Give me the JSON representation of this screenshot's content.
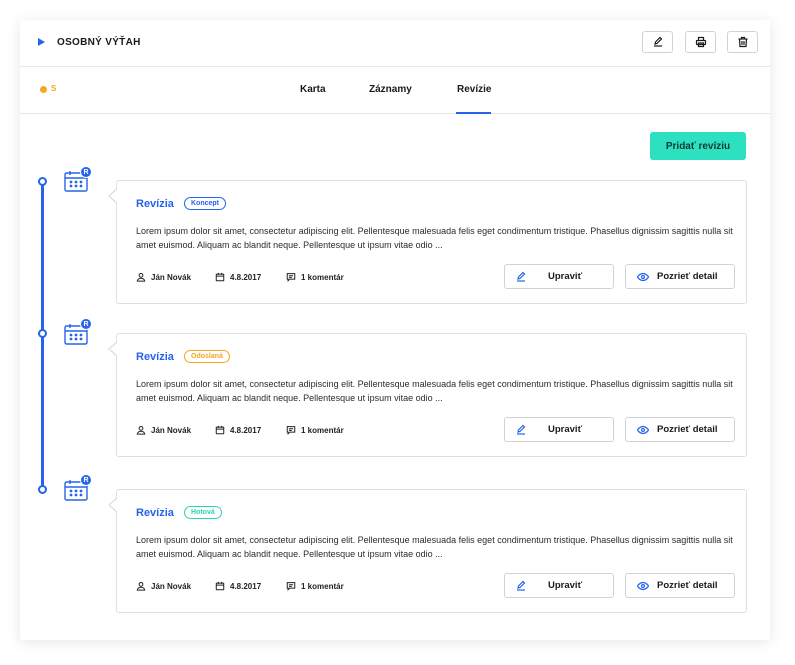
{
  "header": {
    "title": "OSOBNÝ VÝŤAH",
    "actions": [
      "edit-icon",
      "print-icon",
      "trash-icon"
    ]
  },
  "status": {
    "label": "S",
    "color": "#f5a623"
  },
  "tabs": [
    {
      "label": "Karta",
      "active": false
    },
    {
      "label": "Záznamy",
      "active": false
    },
    {
      "label": "Revízie",
      "active": true
    }
  ],
  "add_button": {
    "label": "Pridať revíziu"
  },
  "calendar_badge": "R",
  "revisions": [
    {
      "title": "Revízia",
      "status": "Koncept",
      "status_color": "#2563eb",
      "text": "Lorem ipsum dolor sit amet, consectetur adipiscing elit. Pellentesque malesuada felis eget condimentum tristique. Phasellus dignissim sagittis nulla sit amet euismod. Aliquam ac blandit neque. Pellentesque ut ipsum vitae odio ...",
      "author": "Ján Novák",
      "date": "4.8.2017",
      "comments": "1 komentár",
      "edit_label": "Upraviť",
      "detail_label": "Pozrieť detail"
    },
    {
      "title": "Revízia",
      "status": "Odoslaná",
      "status_color": "#f5a623",
      "text": "Lorem ipsum dolor sit amet, consectetur adipiscing elit. Pellentesque malesuada felis eget condimentum tristique. Phasellus dignissim sagittis nulla sit amet euismod. Aliquam ac blandit neque. Pellentesque ut ipsum vitae odio ...",
      "author": "Ján Novák",
      "date": "4.8.2017",
      "comments": "1 komentár",
      "edit_label": "Upraviť",
      "detail_label": "Pozrieť detail"
    },
    {
      "title": "Revízia",
      "status": "Hotová",
      "status_color": "#2bd4b4",
      "text": "Lorem ipsum dolor sit amet, consectetur adipiscing elit. Pellentesque malesuada felis eget condimentum tristique. Phasellus dignissim sagittis nulla sit amet euismod. Aliquam ac blandit neque. Pellentesque ut ipsum vitae odio ...",
      "author": "Ján Novák",
      "date": "4.8.2017",
      "comments": "1 komentár",
      "edit_label": "Upraviť",
      "detail_label": "Pozrieť detail"
    }
  ],
  "colors": {
    "accent": "#2563eb",
    "primary_button": "#2de0c0"
  }
}
